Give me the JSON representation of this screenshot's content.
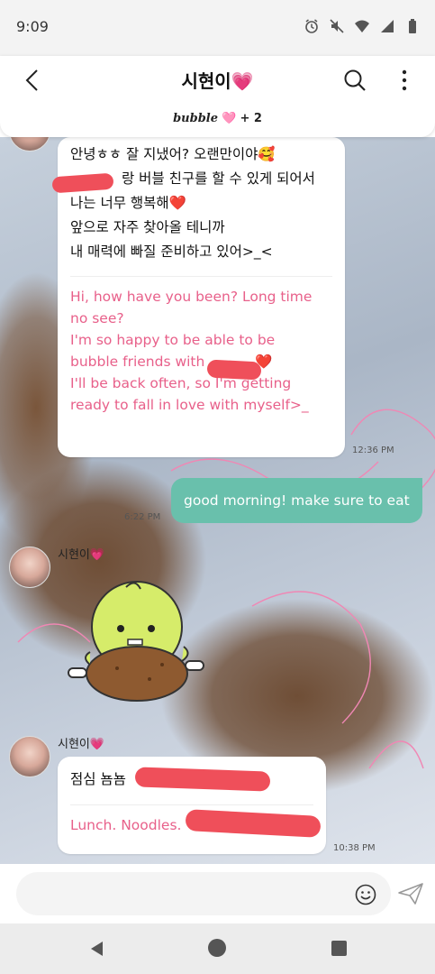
{
  "status_bar": {
    "time": "9:09",
    "icons": [
      "alarm-icon",
      "mute-icon",
      "wifi-icon",
      "signal-icon",
      "battery-icon"
    ]
  },
  "header": {
    "title": "시현이💗",
    "bubble_brand": "bubble",
    "bubble_heart": "🩷",
    "bubble_count": "+ 2"
  },
  "messages": [
    {
      "type": "incoming-card",
      "ko_lines": [
        "안녕ㅎㅎ 잘 지냈어? 오랜만이야🥰",
        "랑 버블 친구를 할 수 있게 되어서",
        "나는 너무 행복해❤️",
        "앞으로 자주 찾아올 테니까",
        "내 매력에 빠질 준비하고 있어>_<"
      ],
      "en_lines": [
        "Hi, how have you been? Long time",
        "no see?",
        "I'm so happy to be able to be",
        "bubble friends with",
        "I'll be back often, so I'm getting",
        "ready to fall in love with myself>_"
      ],
      "en_heart": "❤️",
      "time": "12:36 PM"
    },
    {
      "type": "outgoing",
      "text": "good morning! make sure to eat",
      "time": "6:22 PM"
    },
    {
      "type": "incoming-sticker",
      "sender": "시현이💗"
    },
    {
      "type": "incoming-card",
      "sender": "시현이💗",
      "ko_lines": [
        "점심 뇸뇸"
      ],
      "en_lines": [
        "Lunch. Noodles."
      ],
      "time": "10:38 PM"
    }
  ],
  "input": {
    "placeholder": ""
  },
  "colors": {
    "accent_green": "#69c0ac",
    "translation_pink": "#e8608a",
    "redaction_red": "#ef4f5a"
  }
}
